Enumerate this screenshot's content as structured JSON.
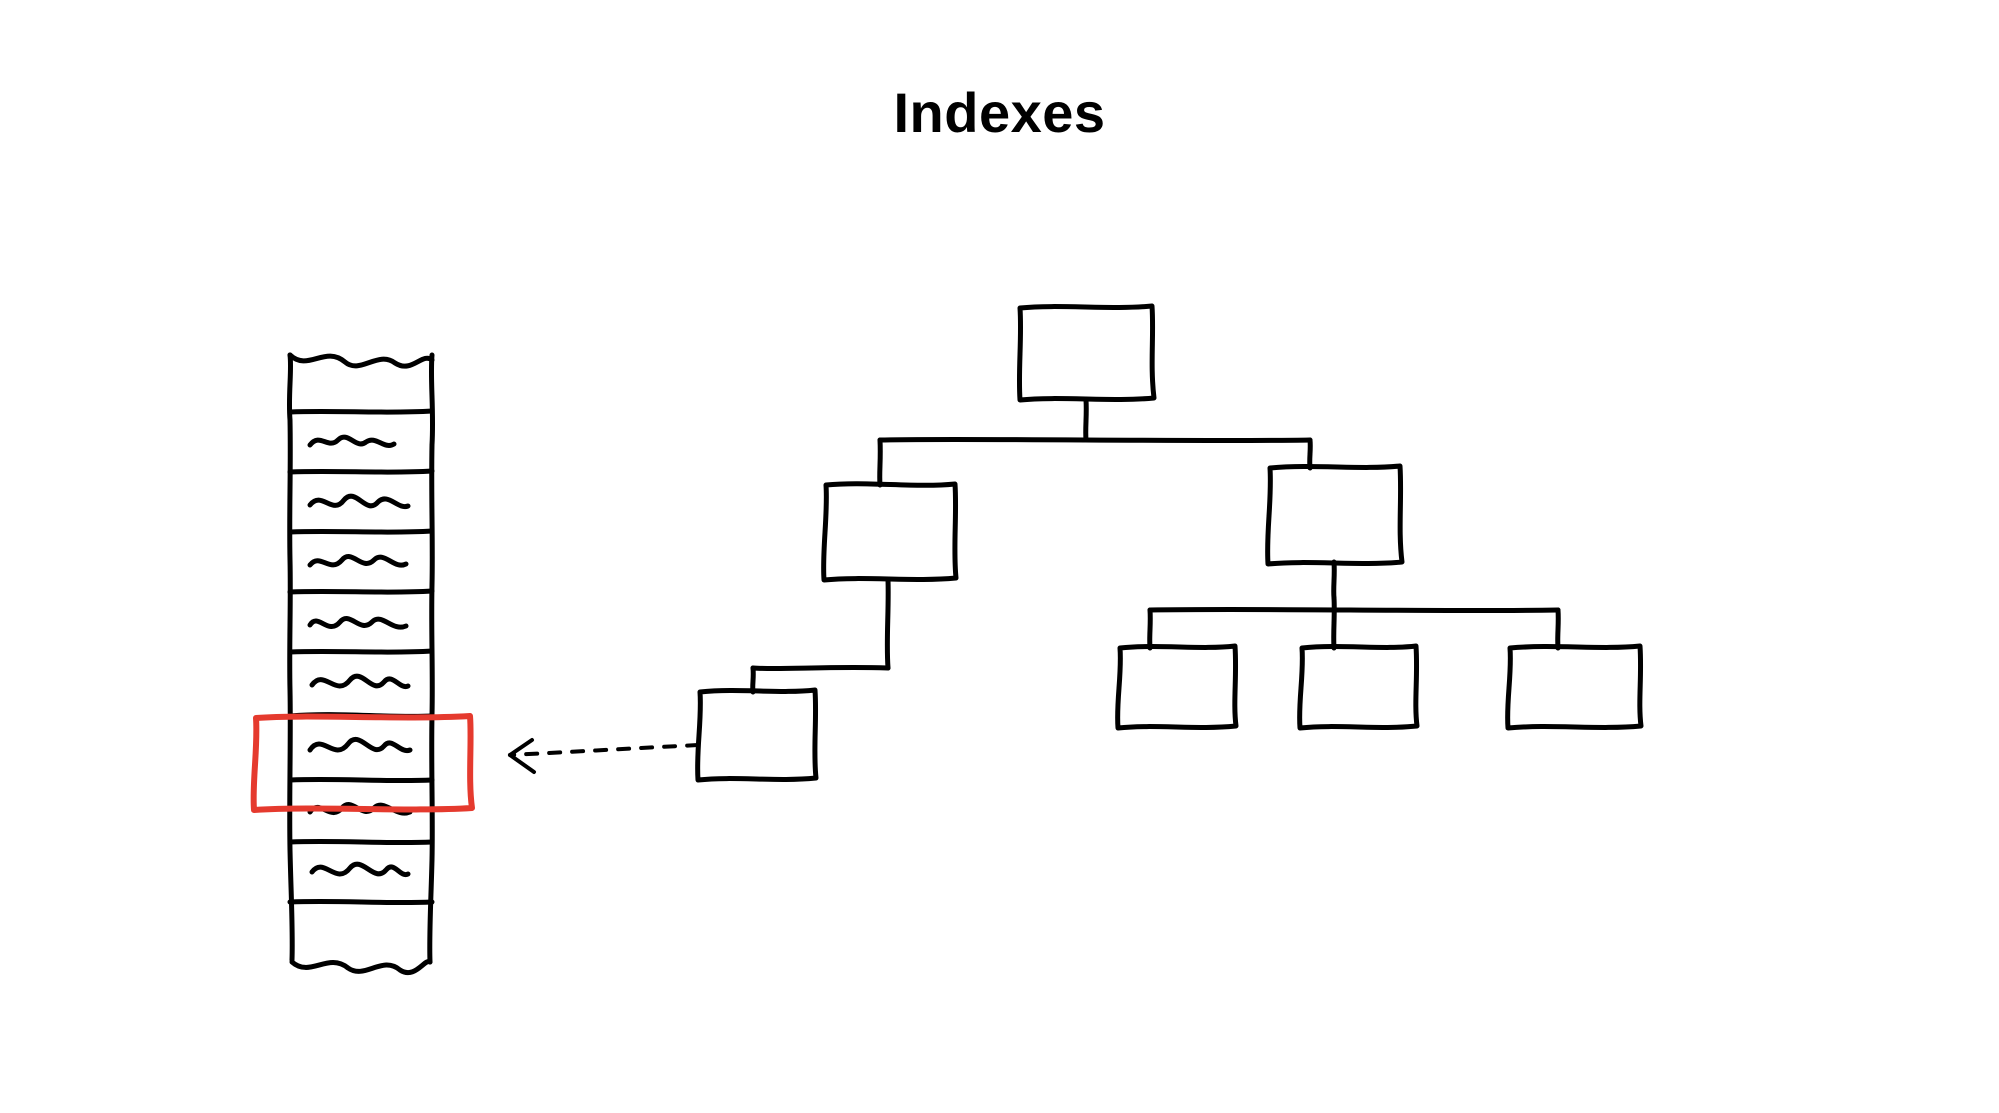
{
  "title": "Indexes",
  "colors": {
    "stroke": "#000000",
    "highlight": "#e53a2e",
    "background": "#ffffff"
  },
  "diagram": {
    "description": "Hand-drawn illustration of a B-tree index pointing to a highlighted row in a table/record strip",
    "table_rows": 8,
    "highlighted_row_index": 5,
    "tree": {
      "root": {
        "children": 2
      },
      "left_child": {
        "children": 1
      },
      "right_child": {
        "children": 3
      },
      "leaf_points_to_row": true
    }
  }
}
